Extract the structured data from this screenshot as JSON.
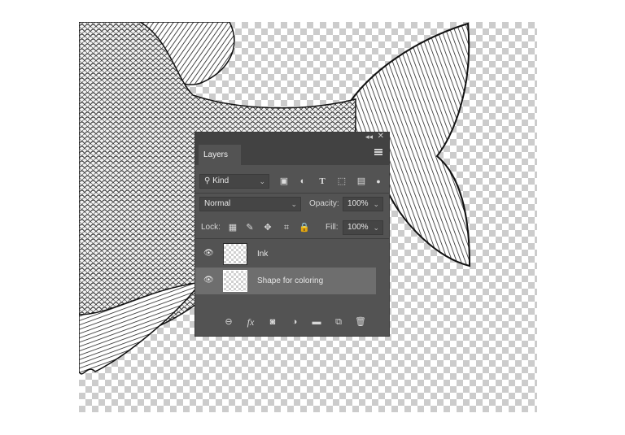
{
  "panel": {
    "tab_label": "Layers",
    "collapse_glyph": "◂◂",
    "close_glyph": "✕",
    "filter": {
      "kind_label": "Kind",
      "filter_icons": [
        "pixel-filter-icon",
        "adjustment-filter-icon",
        "type-filter-icon",
        "shape-filter-icon",
        "smart-object-filter-icon",
        "filter-toggle-icon"
      ]
    },
    "blend_mode": "Normal",
    "opacity_label": "Opacity:",
    "opacity_value": "100%",
    "lock_label": "Lock:",
    "lock_icons": [
      "lock-transparent-icon",
      "lock-image-icon",
      "lock-position-icon",
      "lock-artboard-icon",
      "lock-all-icon"
    ],
    "fill_label": "Fill:",
    "fill_value": "100%",
    "layers": [
      {
        "name": "Ink",
        "visible": true,
        "selected": false
      },
      {
        "name": "Shape for coloring",
        "visible": true,
        "selected": true
      }
    ],
    "footer_icons": [
      "link-layers-icon",
      "fx-icon",
      "add-mask-icon",
      "adjustment-layer-icon",
      "group-folder-icon",
      "new-layer-icon",
      "trash-icon"
    ],
    "fx_label": "fx"
  },
  "colors": {
    "panel_bg": "#535353",
    "panel_header": "#424242",
    "selected_row": "#6e6e6e",
    "checker": "#cccccc"
  }
}
